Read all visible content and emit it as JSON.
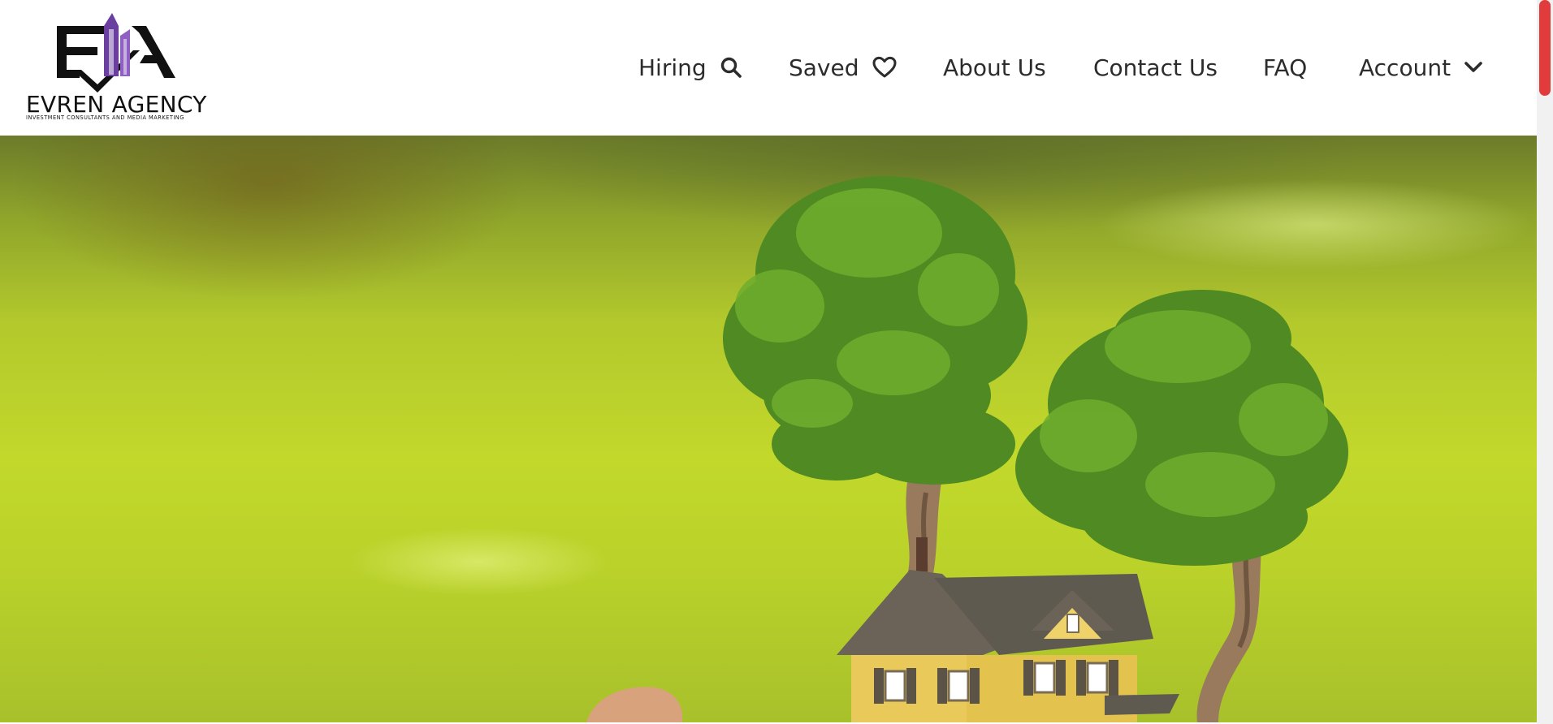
{
  "brand": {
    "name": "EVREN AGENCY",
    "tagline": "INVESTMENT CONSULTANTS AND MEDIA MARKETING",
    "monogram": "EA",
    "accent_color": "#6b3fa0"
  },
  "nav": {
    "items": [
      {
        "label": "Hiring",
        "icon": "search-icon"
      },
      {
        "label": "Saved",
        "icon": "heart-icon"
      },
      {
        "label": "About Us"
      },
      {
        "label": "Contact Us"
      },
      {
        "label": "FAQ"
      },
      {
        "label": "Account",
        "icon": "chevron-down-icon"
      }
    ]
  },
  "hero": {
    "image": "model house on hand with two bonsai trees on green background"
  },
  "scrollbar": {
    "thumb_color": "#e23b3b",
    "position": 0
  }
}
